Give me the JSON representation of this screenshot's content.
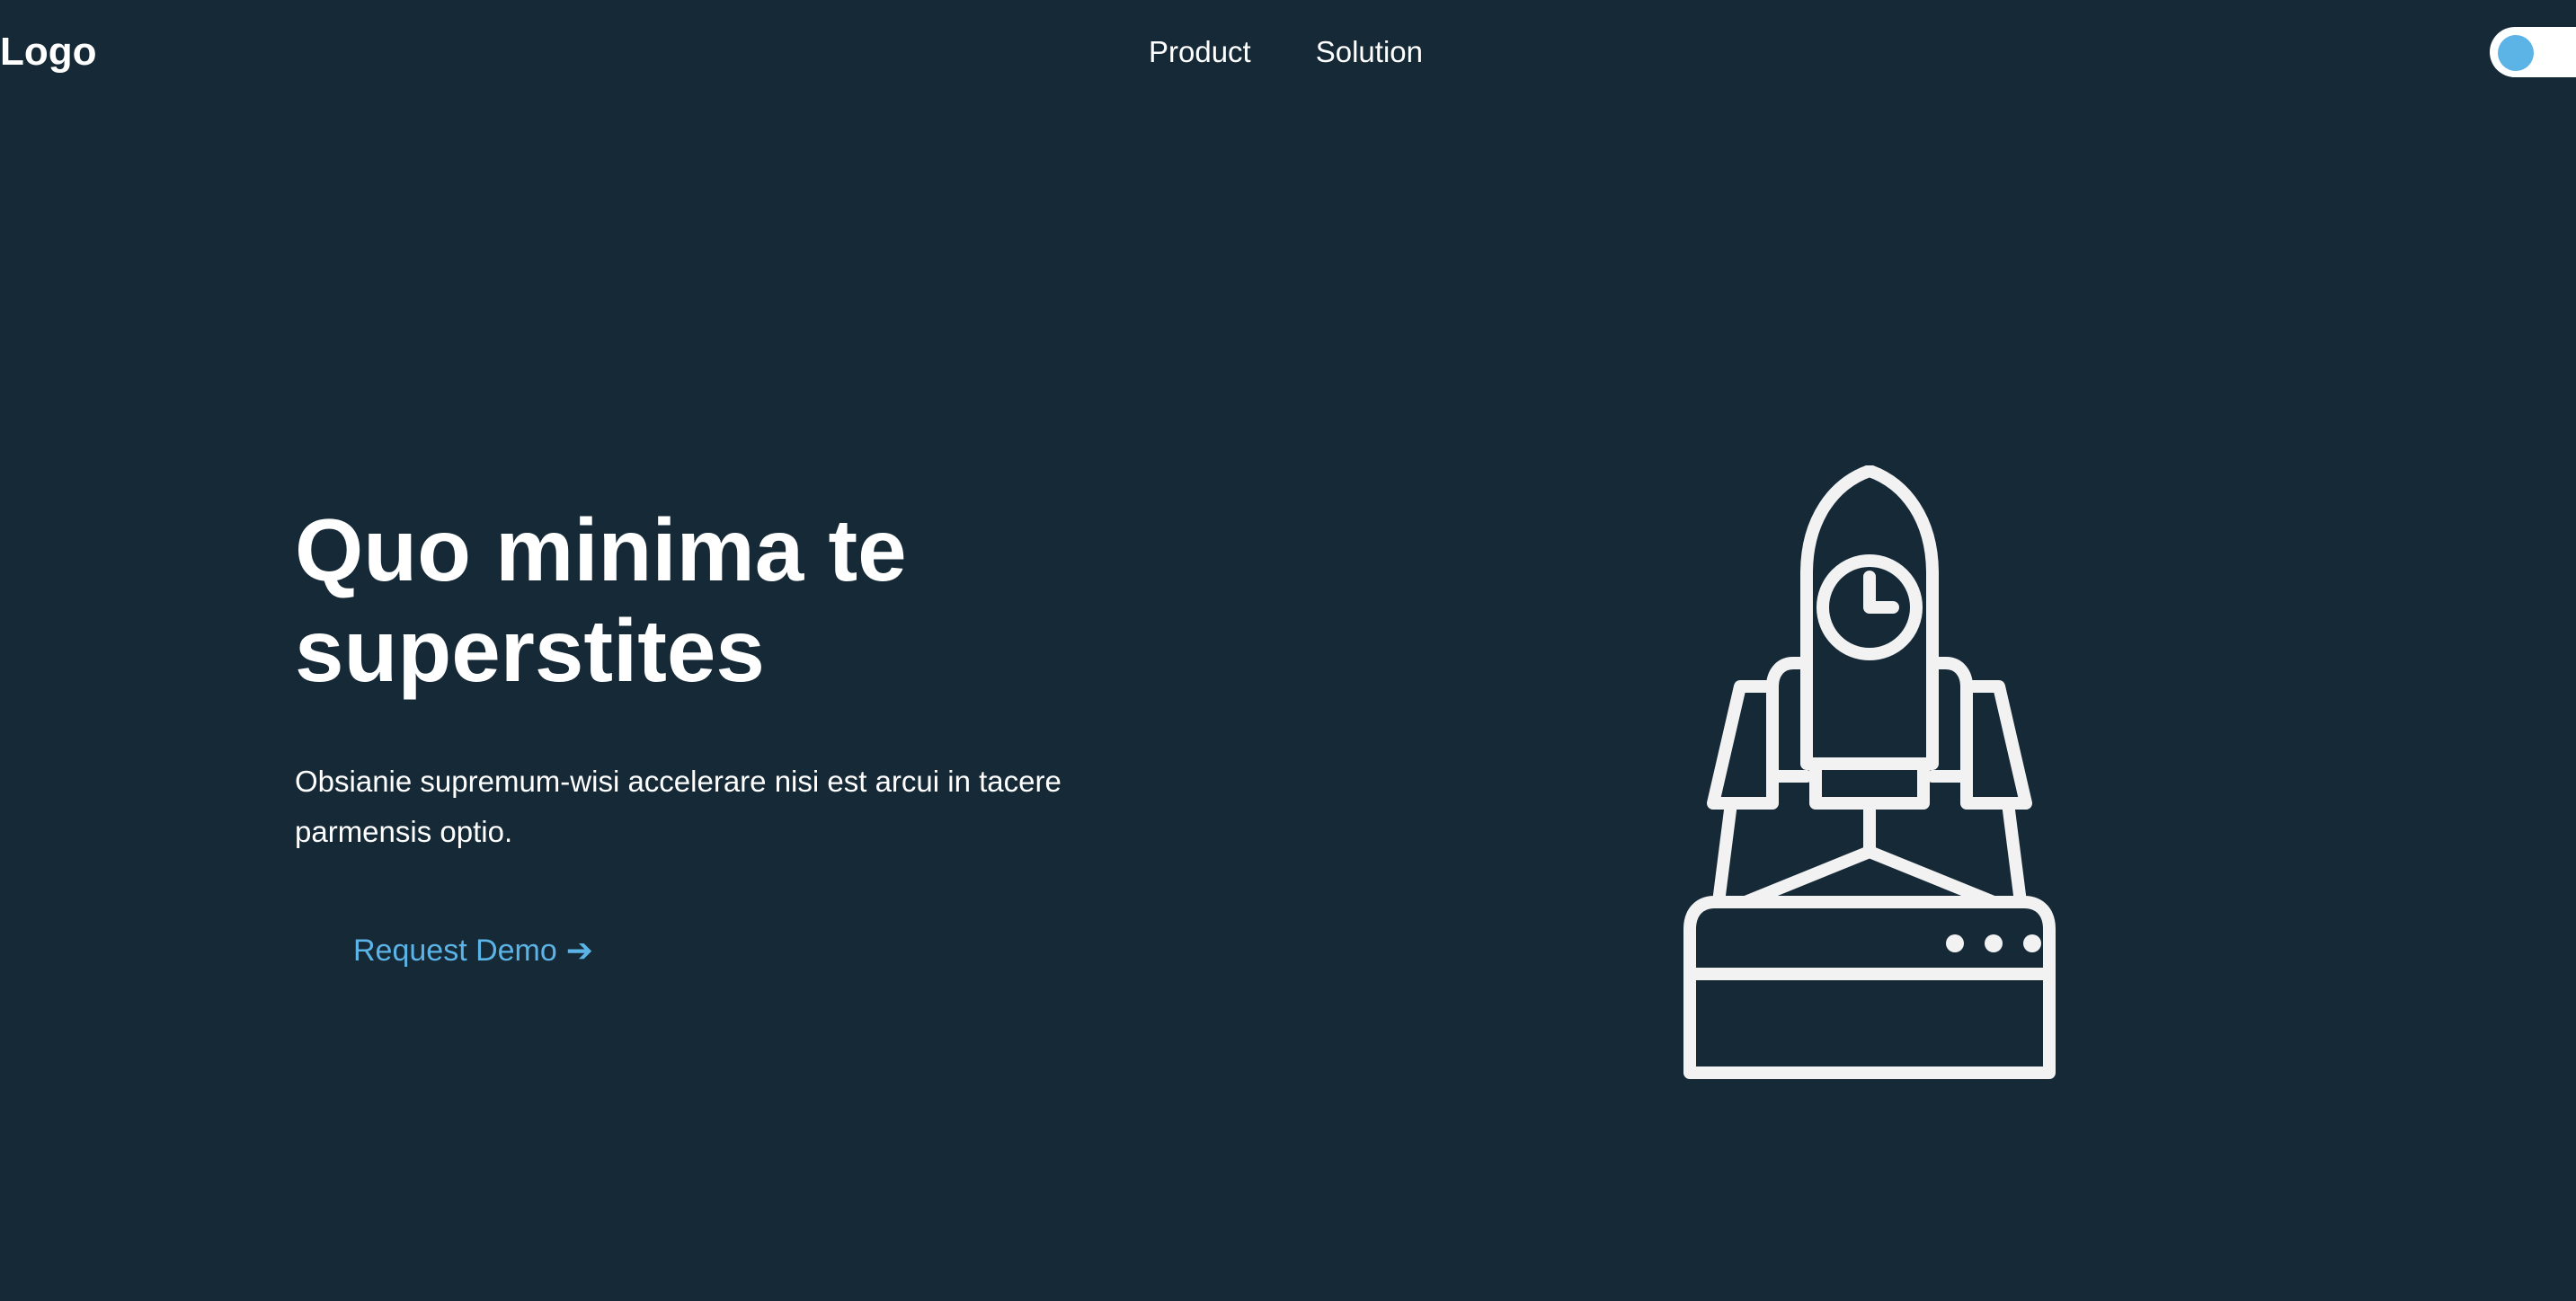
{
  "header": {
    "logo": "Logo",
    "nav": [
      {
        "label": "Product"
      },
      {
        "label": "Solution"
      }
    ],
    "theme_toggle": {
      "state": "off"
    }
  },
  "hero": {
    "title": "Quo minima te superstites",
    "subtitle": "Obsianie supremum-wisi accelerare nisi est arcui in tacere parmensis optio.",
    "cta_label": "Request Demo",
    "cta_arrow": "➔",
    "illustration_icon": "rocket-launch-icon"
  },
  "colors": {
    "background": "#162937",
    "text": "#ffffff",
    "accent": "#5cb3e6",
    "illustration_stroke": "#f2f2f2"
  }
}
